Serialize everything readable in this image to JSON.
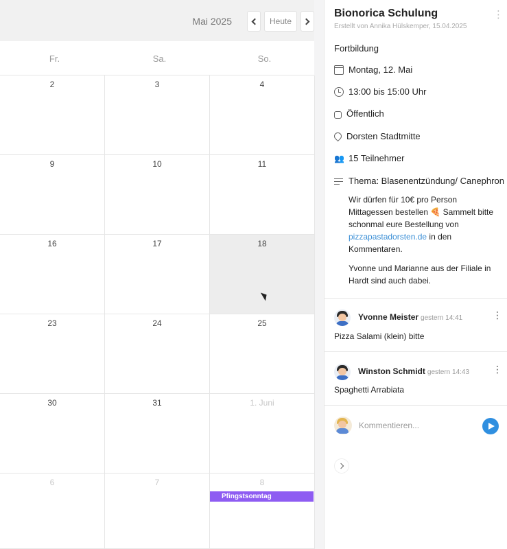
{
  "calendar": {
    "month_label": "Mai 2025",
    "today_label": "Heute",
    "weekdays": [
      "Fr.",
      "Sa.",
      "So."
    ],
    "weeks": [
      [
        "2",
        "3",
        "4"
      ],
      [
        "9",
        "10",
        "11"
      ],
      [
        "16",
        "17",
        "18"
      ],
      [
        "23",
        "24",
        "25"
      ],
      [
        "30",
        "31",
        "1. Juni"
      ],
      [
        "6",
        "7",
        "8"
      ]
    ],
    "event": {
      "title": "Pfingstsonntag",
      "color": "#8e5cf2"
    }
  },
  "panel": {
    "title": "Bionorica Schulung",
    "created_by": "Erstellt von Annika Hülskemper, 15.04.2025",
    "category": "Fortbildung",
    "date": "Montag, 12. Mai",
    "time": "13:00 bis 15:00 Uhr",
    "visibility": "Öffentlich",
    "location": "Dorsten Stadtmitte",
    "participants": "15 Teilnehmer",
    "topic": "Thema: Blasenentzündung/ Canephron",
    "description": {
      "p1_before": "Wir dürfen für 10€ pro Person Mittagessen bestellen 🍕 Sammelt bitte schonmal eure Bestellung von ",
      "link": "pizzapastadorsten.de",
      "p1_after": " in den Kommentaren.",
      "p2": "Yvonne und Marianne aus der Filiale in Hardt sind auch dabei."
    },
    "comments": [
      {
        "name": "Yvonne Meister",
        "time": "gestern 14:41",
        "text": "Pizza Salami (klein) bitte"
      },
      {
        "name": "Winston Schmidt",
        "time": "gestern 14:43",
        "text": "Spaghetti Arrabiata"
      }
    ],
    "composer": {
      "placeholder": "Kommentieren..."
    }
  },
  "colors": {
    "accent": "#2f8fe0",
    "link": "#3b8fd6",
    "event": "#8e5cf2"
  }
}
